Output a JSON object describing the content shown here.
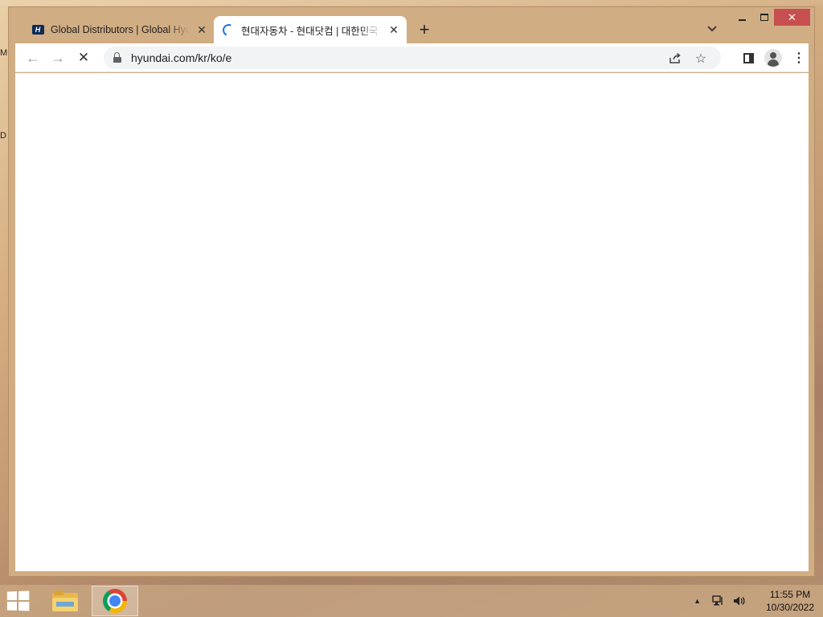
{
  "desktop": {
    "edge_labels": [
      "M",
      "D"
    ]
  },
  "browser": {
    "tabs": [
      {
        "title": "Global Distributors | Global Hyundai",
        "favicon": "hyundai-logo",
        "favicon_text": "H",
        "active": false
      },
      {
        "title": "현대자동차 - 현대닷컴 | 대한민국",
        "favicon": "loading-spinner",
        "active": true
      }
    ],
    "new_tab_label": "+",
    "tab_search_icon": "chevron-down-icon",
    "window_controls": {
      "minimize": "minimize",
      "maximize": "maximize",
      "close": "✕"
    },
    "toolbar": {
      "back_icon": "←",
      "forward_icon": "→",
      "stop_icon": "✕",
      "url": "hyundai.com/kr/ko/e",
      "share_icon": "share-icon",
      "star_icon": "☆",
      "menu_icon": "⋮"
    }
  },
  "taskbar": {
    "apps": [
      "File Explorer",
      "Google Chrome"
    ],
    "tray_arrow": "▲",
    "clock": {
      "time": "11:55 PM",
      "date": "10/30/2022"
    }
  },
  "colors": {
    "close_button": "#c74f4f",
    "spinner": "#1a73e8",
    "window_frame": "#d1ad84"
  }
}
